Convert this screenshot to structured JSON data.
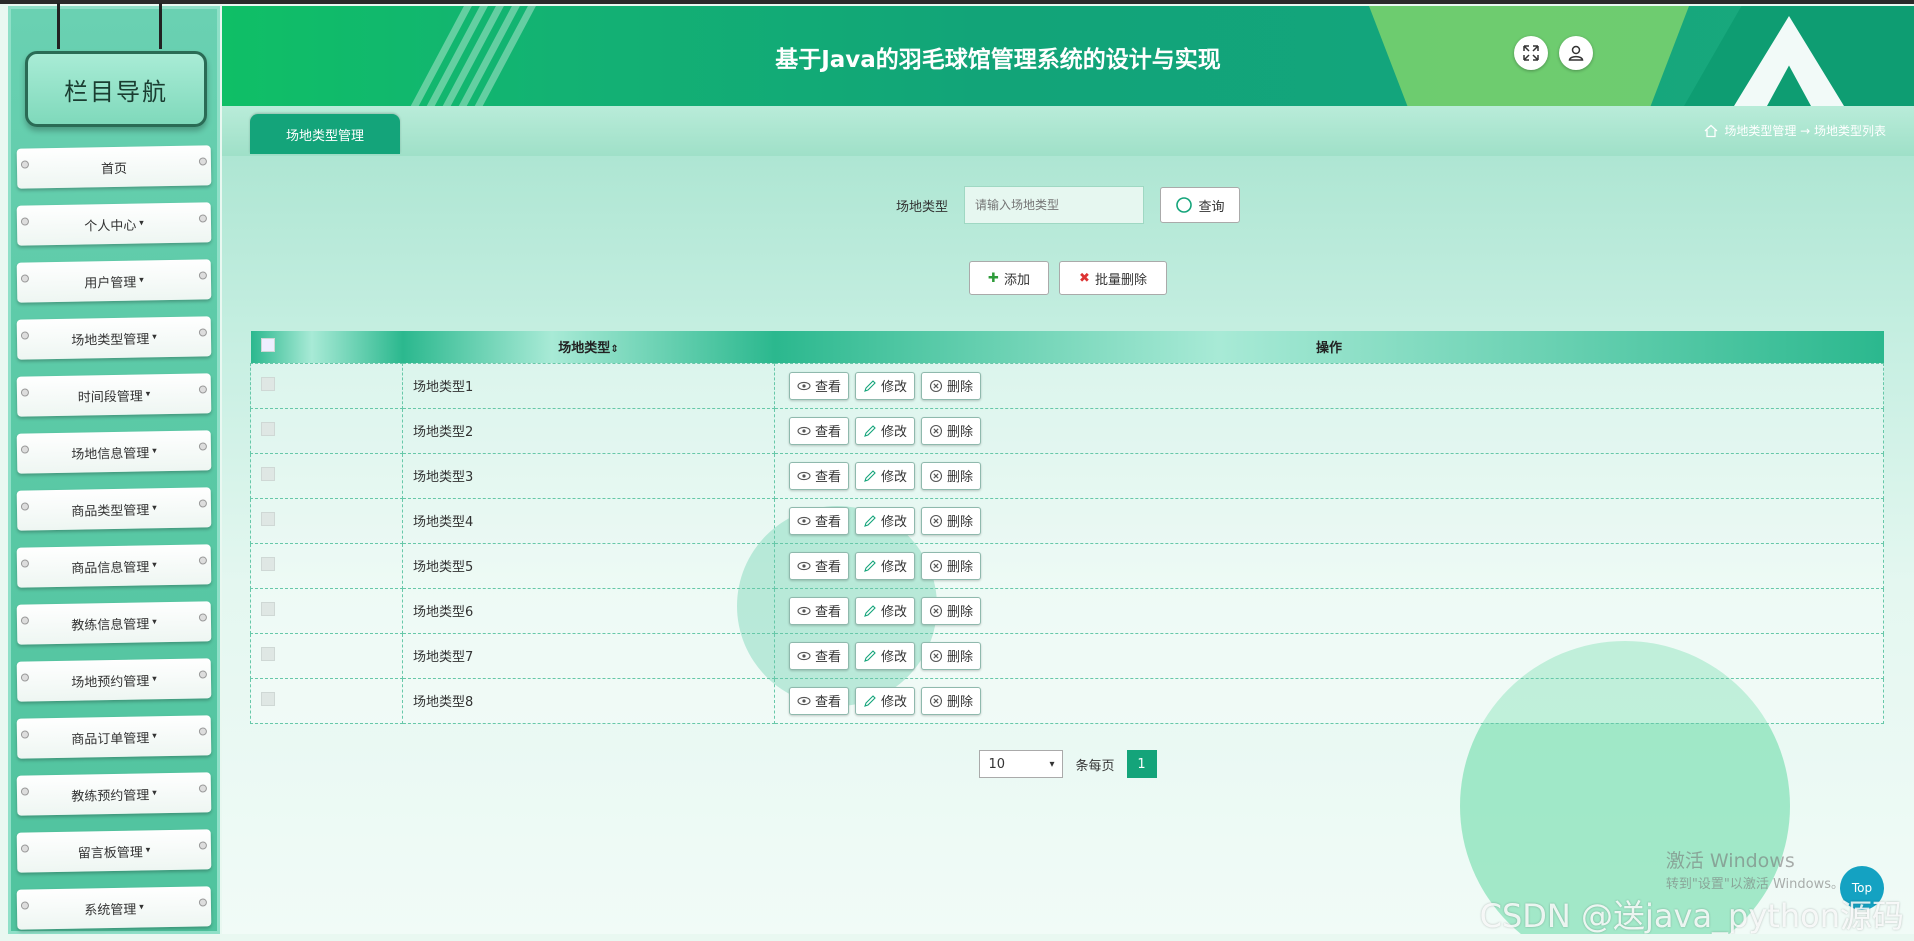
{
  "sidebar": {
    "title": "栏目导航",
    "items": [
      {
        "label": "首页",
        "caret": ""
      },
      {
        "label": "个人中心",
        "caret": "▾"
      },
      {
        "label": "用户管理",
        "caret": "▾"
      },
      {
        "label": "场地类型管理",
        "caret": "▾"
      },
      {
        "label": "时间段管理",
        "caret": "▾"
      },
      {
        "label": "场地信息管理",
        "caret": "▾"
      },
      {
        "label": "商品类型管理",
        "caret": "▾"
      },
      {
        "label": "商品信息管理",
        "caret": "▾"
      },
      {
        "label": "教练信息管理",
        "caret": "▾"
      },
      {
        "label": "场地预约管理",
        "caret": "▾"
      },
      {
        "label": "商品订单管理",
        "caret": "▾"
      },
      {
        "label": "教练预约管理",
        "caret": "▾"
      },
      {
        "label": "留言板管理",
        "caret": "▾"
      },
      {
        "label": "系统管理",
        "caret": "▾"
      }
    ]
  },
  "header": {
    "title": "基于Java的羽毛球馆管理系统的设计与实现",
    "fullscreen_icon": "expand-icon",
    "user_icon": "user-icon"
  },
  "tabbar": {
    "tab_label": "场地类型管理",
    "breadcrumb": "场地类型管理 → 场地类型列表",
    "home_icon": "home-icon"
  },
  "search": {
    "label": "场地类型",
    "placeholder": "请输入场地类型",
    "query_label": "查询"
  },
  "actions": {
    "add_label": "添加",
    "batch_delete_label": "批量删除"
  },
  "table": {
    "headers": {
      "name": "场地类型",
      "sort": "⇕",
      "ops": "操作"
    },
    "op_labels": {
      "view": "查看",
      "edit": "修改",
      "delete": "删除"
    },
    "rows": [
      "场地类型1",
      "场地类型2",
      "场地类型3",
      "场地类型4",
      "场地类型5",
      "场地类型6",
      "场地类型7",
      "场地类型8"
    ]
  },
  "pagination": {
    "page_size": "10",
    "per_page_label": "条每页",
    "current_page": "1"
  },
  "overlay": {
    "watermark_line1": "激活 Windows",
    "watermark_line2": "转到\"设置\"以激活 Windows。",
    "csdn": "CSDN @送java_python源码",
    "top_label": "Top"
  },
  "colors": {
    "accent": "#14a47a",
    "header": "#12a478",
    "sidebar": "#5ccaa7"
  }
}
